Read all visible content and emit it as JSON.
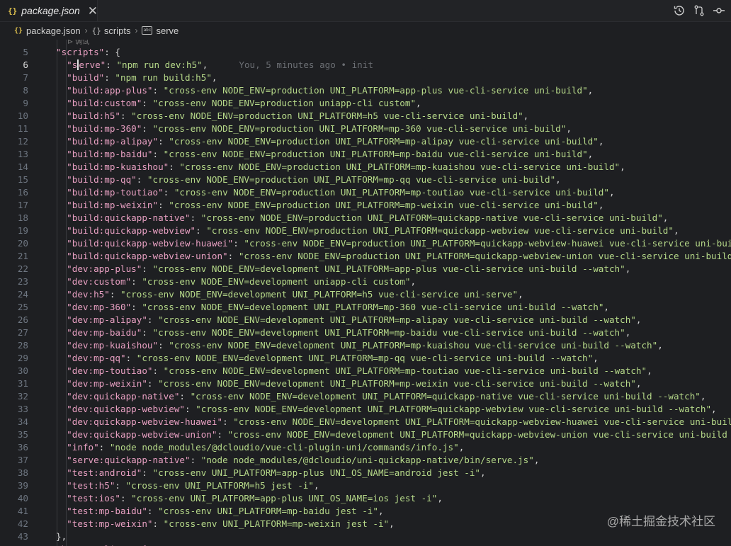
{
  "tab": {
    "title": "package.json",
    "icon": "{}",
    "close": "✕"
  },
  "breadcrumb": {
    "file": "package.json",
    "group": "scripts",
    "item": "serve",
    "file_icon": "{}",
    "group_icon": "{}",
    "item_icon": "abc"
  },
  "codelens": "⊳ 调试",
  "editor": {
    "active_line": 6,
    "blame": "You, 5 minutes ago • init",
    "scripts_open": {
      "line": 5,
      "key": "\"scripts\"",
      "rest": ": {"
    },
    "close_brace": {
      "line": 43,
      "text": "},"
    },
    "entries": [
      {
        "line": 6,
        "key": "serve",
        "value": "npm run dev:h5"
      },
      {
        "line": 7,
        "key": "build",
        "value": "npm run build:h5"
      },
      {
        "line": 8,
        "key": "build:app-plus",
        "value": "cross-env NODE_ENV=production UNI_PLATFORM=app-plus vue-cli-service uni-build"
      },
      {
        "line": 9,
        "key": "build:custom",
        "value": "cross-env NODE_ENV=production uniapp-cli custom"
      },
      {
        "line": 10,
        "key": "build:h5",
        "value": "cross-env NODE_ENV=production UNI_PLATFORM=h5 vue-cli-service uni-build"
      },
      {
        "line": 11,
        "key": "build:mp-360",
        "value": "cross-env NODE_ENV=production UNI_PLATFORM=mp-360 vue-cli-service uni-build"
      },
      {
        "line": 12,
        "key": "build:mp-alipay",
        "value": "cross-env NODE_ENV=production UNI_PLATFORM=mp-alipay vue-cli-service uni-build"
      },
      {
        "line": 13,
        "key": "build:mp-baidu",
        "value": "cross-env NODE_ENV=production UNI_PLATFORM=mp-baidu vue-cli-service uni-build"
      },
      {
        "line": 14,
        "key": "build:mp-kuaishou",
        "value": "cross-env NODE_ENV=production UNI_PLATFORM=mp-kuaishou vue-cli-service uni-build"
      },
      {
        "line": 15,
        "key": "build:mp-qq",
        "value": "cross-env NODE_ENV=production UNI_PLATFORM=mp-qq vue-cli-service uni-build"
      },
      {
        "line": 16,
        "key": "build:mp-toutiao",
        "value": "cross-env NODE_ENV=production UNI_PLATFORM=mp-toutiao vue-cli-service uni-build"
      },
      {
        "line": 17,
        "key": "build:mp-weixin",
        "value": "cross-env NODE_ENV=production UNI_PLATFORM=mp-weixin vue-cli-service uni-build"
      },
      {
        "line": 18,
        "key": "build:quickapp-native",
        "value": "cross-env NODE_ENV=production UNI_PLATFORM=quickapp-native vue-cli-service uni-build"
      },
      {
        "line": 19,
        "key": "build:quickapp-webview",
        "value": "cross-env NODE_ENV=production UNI_PLATFORM=quickapp-webview vue-cli-service uni-build"
      },
      {
        "line": 20,
        "key": "build:quickapp-webview-huawei",
        "value": "cross-env NODE_ENV=production UNI_PLATFORM=quickapp-webview-huawei vue-cli-service uni-build"
      },
      {
        "line": 21,
        "key": "build:quickapp-webview-union",
        "value": "cross-env NODE_ENV=production UNI_PLATFORM=quickapp-webview-union vue-cli-service uni-build"
      },
      {
        "line": 22,
        "key": "dev:app-plus",
        "value": "cross-env NODE_ENV=development UNI_PLATFORM=app-plus vue-cli-service uni-build --watch"
      },
      {
        "line": 23,
        "key": "dev:custom",
        "value": "cross-env NODE_ENV=development uniapp-cli custom"
      },
      {
        "line": 24,
        "key": "dev:h5",
        "value": "cross-env NODE_ENV=development UNI_PLATFORM=h5 vue-cli-service uni-serve"
      },
      {
        "line": 25,
        "key": "dev:mp-360",
        "value": "cross-env NODE_ENV=development UNI_PLATFORM=mp-360 vue-cli-service uni-build --watch"
      },
      {
        "line": 26,
        "key": "dev:mp-alipay",
        "value": "cross-env NODE_ENV=development UNI_PLATFORM=mp-alipay vue-cli-service uni-build --watch"
      },
      {
        "line": 27,
        "key": "dev:mp-baidu",
        "value": "cross-env NODE_ENV=development UNI_PLATFORM=mp-baidu vue-cli-service uni-build --watch"
      },
      {
        "line": 28,
        "key": "dev:mp-kuaishou",
        "value": "cross-env NODE_ENV=development UNI_PLATFORM=mp-kuaishou vue-cli-service uni-build --watch"
      },
      {
        "line": 29,
        "key": "dev:mp-qq",
        "value": "cross-env NODE_ENV=development UNI_PLATFORM=mp-qq vue-cli-service uni-build --watch"
      },
      {
        "line": 30,
        "key": "dev:mp-toutiao",
        "value": "cross-env NODE_ENV=development UNI_PLATFORM=mp-toutiao vue-cli-service uni-build --watch"
      },
      {
        "line": 31,
        "key": "dev:mp-weixin",
        "value": "cross-env NODE_ENV=development UNI_PLATFORM=mp-weixin vue-cli-service uni-build --watch"
      },
      {
        "line": 32,
        "key": "dev:quickapp-native",
        "value": "cross-env NODE_ENV=development UNI_PLATFORM=quickapp-native vue-cli-service uni-build --watch"
      },
      {
        "line": 33,
        "key": "dev:quickapp-webview",
        "value": "cross-env NODE_ENV=development UNI_PLATFORM=quickapp-webview vue-cli-service uni-build --watch"
      },
      {
        "line": 34,
        "key": "dev:quickapp-webview-huawei",
        "value": "cross-env NODE_ENV=development UNI_PLATFORM=quickapp-webview-huawei vue-cli-service uni-build --wa"
      },
      {
        "line": 35,
        "key": "dev:quickapp-webview-union",
        "value": "cross-env NODE_ENV=development UNI_PLATFORM=quickapp-webview-union vue-cli-service uni-build --watc"
      },
      {
        "line": 36,
        "key": "info",
        "value": "node node_modules/@dcloudio/vue-cli-plugin-uni/commands/info.js"
      },
      {
        "line": 37,
        "key": "serve:quickapp-native",
        "value": "node node_modules/@dcloudio/uni-quickapp-native/bin/serve.js"
      },
      {
        "line": 38,
        "key": "test:android",
        "value": "cross-env UNI_PLATFORM=app-plus UNI_OS_NAME=android jest -i"
      },
      {
        "line": 39,
        "key": "test:h5",
        "value": "cross-env UNI_PLATFORM=h5 jest -i"
      },
      {
        "line": 40,
        "key": "test:ios",
        "value": "cross-env UNI_PLATFORM=app-plus UNI_OS_NAME=ios jest -i"
      },
      {
        "line": 41,
        "key": "test:mp-baidu",
        "value": "cross-env UNI_PLATFORM=mp-baidu jest -i"
      },
      {
        "line": 42,
        "key": "test:mp-weixin",
        "value": "cross-env UNI_PLATFORM=mp-weixin jest -i"
      }
    ],
    "partial_line": {
      "line": 44,
      "text": "\"browserslist\": ["
    }
  },
  "watermark": "@稀土掘金技术社区",
  "colors": {
    "key": "#e8a0c2",
    "string": "#b6d989",
    "background": "#1e1f22"
  }
}
